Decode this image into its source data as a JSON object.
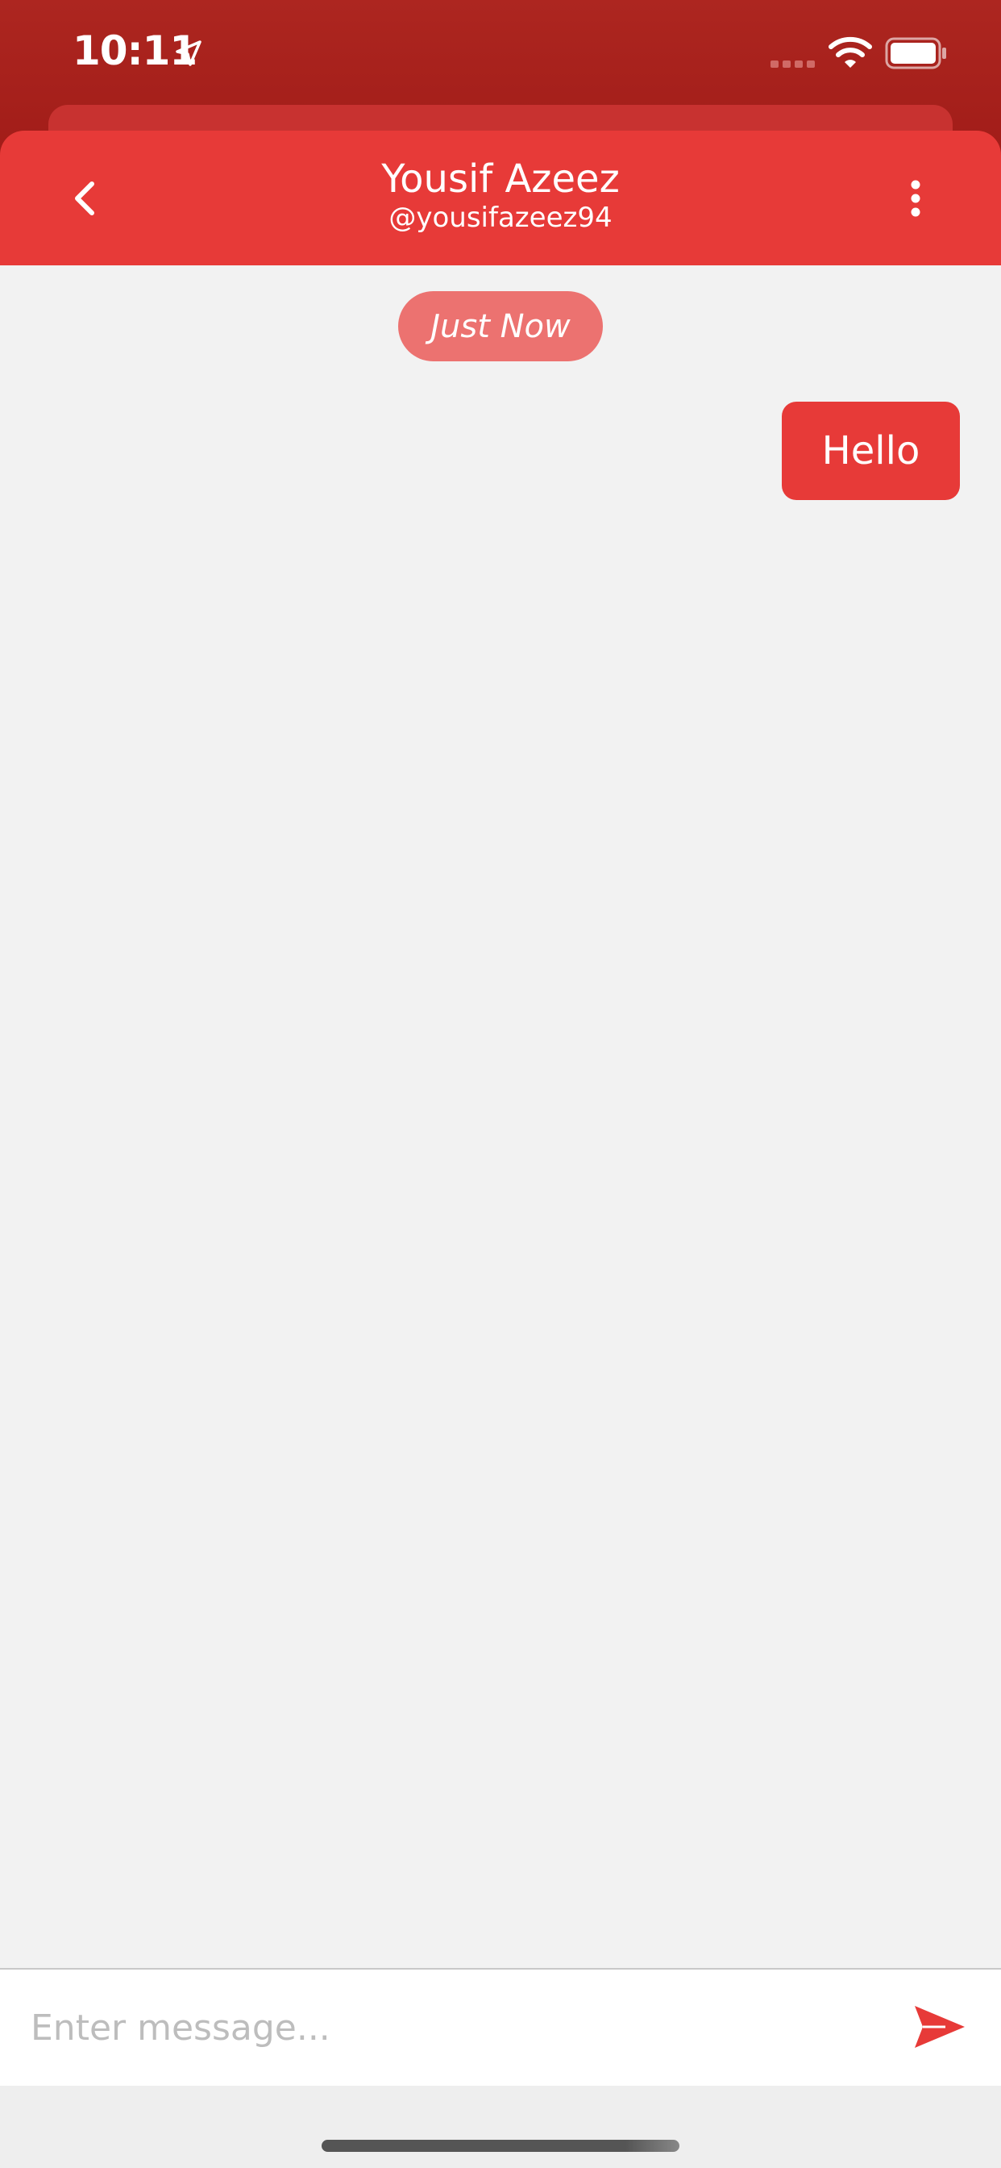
{
  "status_bar": {
    "time": "10:11",
    "icons": [
      "location-arrow-icon",
      "cellular-signal-icon",
      "wifi-icon",
      "battery-icon"
    ]
  },
  "header": {
    "title": "Yousif Azeez",
    "subtitle": "@yousifazeez94",
    "back_icon": "chevron-left-icon",
    "menu_icon": "more-vertical-icon"
  },
  "chat": {
    "timestamp": "Just Now",
    "messages": [
      {
        "text": "Hello",
        "sender": "me"
      }
    ]
  },
  "composer": {
    "placeholder": "Enter message...",
    "value": "",
    "send_icon": "send-icon"
  },
  "colors": {
    "accent": "#e73a38",
    "status_bar": "#a81f1b",
    "timestamp_pill": "#ec7270",
    "background": "#f2f2f2"
  }
}
